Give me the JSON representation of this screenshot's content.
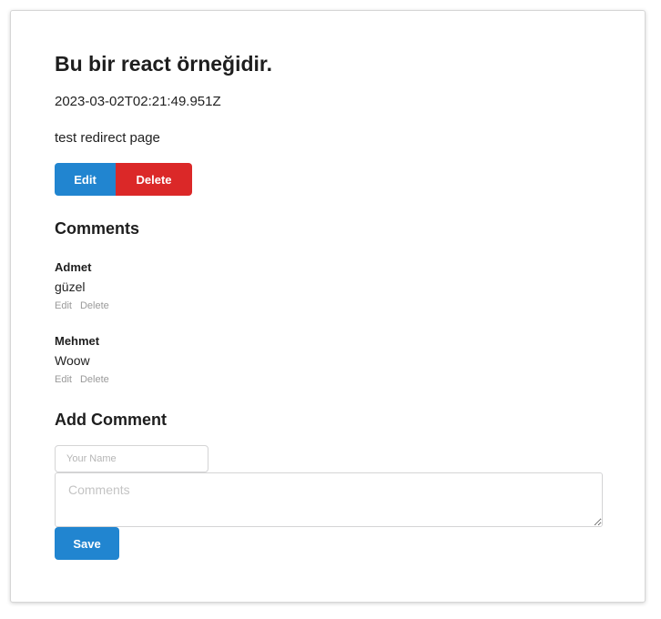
{
  "post": {
    "title": "Bu bir react örneğidir.",
    "date": "2023-03-02T02:21:49.951Z",
    "body": "test redirect page",
    "edit_label": "Edit",
    "delete_label": "Delete"
  },
  "comments": {
    "title": "Comments",
    "items": [
      {
        "author": "Admet",
        "text": "güzel",
        "edit_label": "Edit",
        "delete_label": "Delete"
      },
      {
        "author": "Mehmet",
        "text": "Woow",
        "edit_label": "Edit",
        "delete_label": "Delete"
      }
    ]
  },
  "add_comment": {
    "title": "Add Comment",
    "name_placeholder": "Your Name",
    "name_value": "",
    "comment_placeholder": "Comments",
    "comment_value": "",
    "save_label": "Save"
  },
  "colors": {
    "primary": "#2185d0",
    "danger": "#db2828",
    "muted": "#9a9a9a"
  }
}
